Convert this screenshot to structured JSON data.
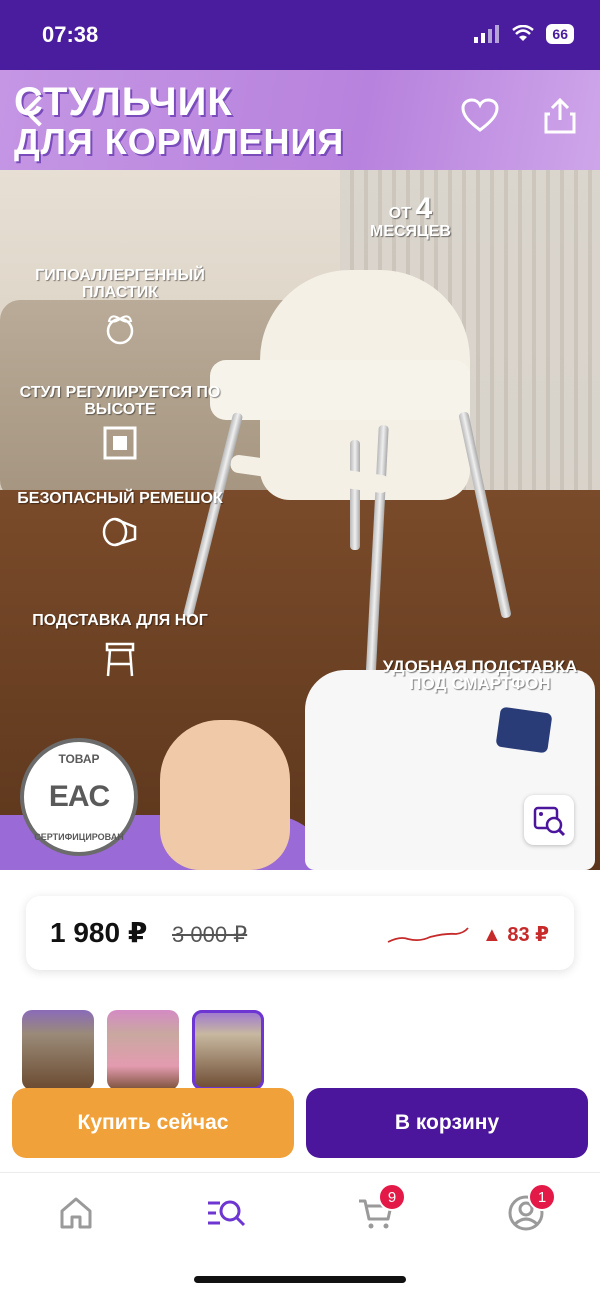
{
  "status": {
    "time": "07:38",
    "battery": "66"
  },
  "hero": {
    "title_line1": "СТУЛЬЧИК",
    "title_line2": "ДЛЯ КОРМЛЕНИЯ",
    "features": [
      {
        "text": "ГИПОАЛЛЕРГЕННЫЙ ПЛАСТИК",
        "icon": "leaf-globe-icon"
      },
      {
        "text": "СТУЛ РЕГУЛИРУЕТСЯ ПО ВЫСОТЕ",
        "icon": "height-adjust-icon"
      },
      {
        "text": "БЕЗОПАСНЫЙ РЕМЕШОК",
        "icon": "strap-icon"
      },
      {
        "text": "ПОДСТАВКА ДЛЯ НОГ",
        "icon": "footrest-icon"
      }
    ],
    "age_prefix": "ОТ",
    "age_number": "4",
    "age_suffix": "МЕСЯЦЕВ",
    "phone_note": "УДОБНАЯ ПОДСТАВКА ПОД СМАРТФОН",
    "eac_top": "ТОВАР",
    "eac_mark": "EAC",
    "eac_bottom": "СЕРТИФИЦИРОВАН"
  },
  "price": {
    "current": "1 980 ₽",
    "old": "3 000 ₽",
    "change": "▲ 83 ₽",
    "trend_color": "#c62a2a"
  },
  "actions": {
    "buy_now": "Купить сейчас",
    "add_to_cart": "В корзину"
  },
  "tabbar": {
    "cart_badge": "9",
    "profile_badge": "1",
    "accent": "#6d35d2"
  }
}
